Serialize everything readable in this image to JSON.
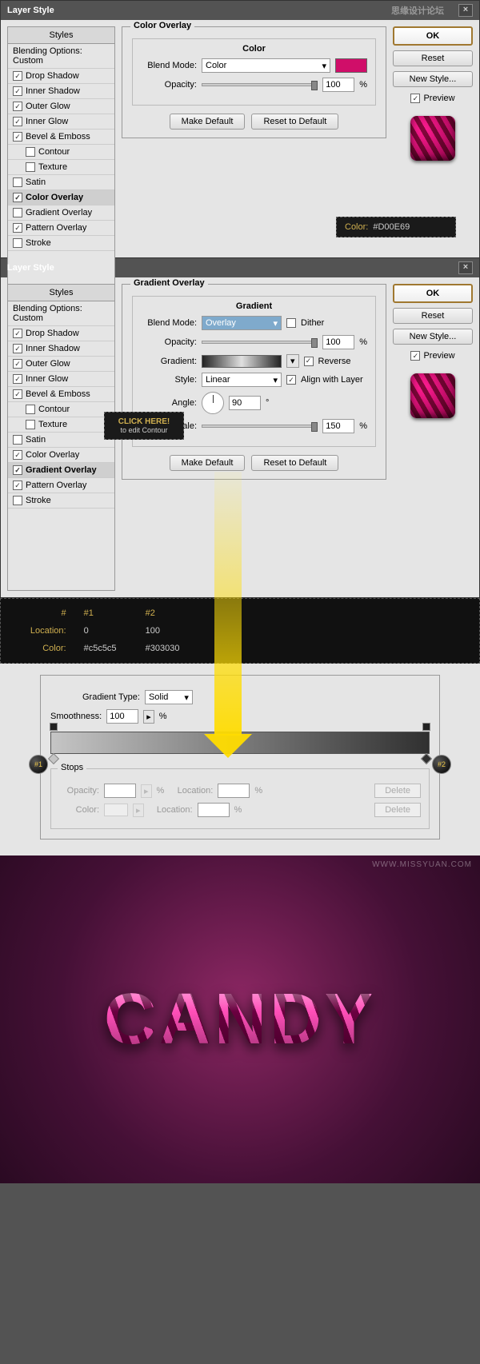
{
  "dialog_title": "Layer Style",
  "watermark_cn": "思缘设计论坛",
  "watermark_url": "WWW.MISSYUAN.COM",
  "styles_header": "Styles",
  "blending_opts": "Blending Options: Custom",
  "effects": [
    {
      "label": "Drop Shadow",
      "checked": true
    },
    {
      "label": "Inner Shadow",
      "checked": true
    },
    {
      "label": "Outer Glow",
      "checked": true
    },
    {
      "label": "Inner Glow",
      "checked": true
    },
    {
      "label": "Bevel & Emboss",
      "checked": true
    },
    {
      "label": "Contour",
      "checked": false,
      "indent": true
    },
    {
      "label": "Texture",
      "checked": false,
      "indent": true
    },
    {
      "label": "Satin",
      "checked": false
    },
    {
      "label": "Color Overlay",
      "checked": true
    },
    {
      "label": "Gradient Overlay",
      "checked": false
    },
    {
      "label": "Pattern Overlay",
      "checked": true
    },
    {
      "label": "Stroke",
      "checked": false
    }
  ],
  "color_overlay": {
    "title": "Color Overlay",
    "subtitle": "Color",
    "blend_label": "Blend Mode:",
    "blend_value": "Color",
    "swatch": "#D00E69",
    "opacity_label": "Opacity:",
    "opacity_value": "100",
    "pct": "%"
  },
  "buttons": {
    "make_default": "Make Default",
    "reset_default": "Reset to Default",
    "ok": "OK",
    "reset": "Reset",
    "new_style": "New Style...",
    "preview": "Preview"
  },
  "tooltip_color": {
    "key": "Color:",
    "val": "#D00E69"
  },
  "click_here": {
    "l1": "CLICK HERE!",
    "l2": "to edit Contour"
  },
  "grad_overlay": {
    "title": "Gradient Overlay",
    "subtitle": "Gradient",
    "blend_label": "Blend Mode:",
    "blend_value": "Overlay",
    "dither": "Dither",
    "opacity_label": "Opacity:",
    "opacity_value": "100",
    "gradient_label": "Gradient:",
    "reverse": "Reverse",
    "style_label": "Style:",
    "style_value": "Linear",
    "align": "Align with Layer",
    "angle_label": "Angle:",
    "angle_value": "90",
    "deg": "°",
    "scale_label": "Scale:",
    "scale_value": "150",
    "pct": "%"
  },
  "effects2": [
    {
      "label": "Drop Shadow",
      "checked": true
    },
    {
      "label": "Inner Shadow",
      "checked": true
    },
    {
      "label": "Outer Glow",
      "checked": true
    },
    {
      "label": "Inner Glow",
      "checked": true
    },
    {
      "label": "Bevel & Emboss",
      "checked": true
    },
    {
      "label": "Contour",
      "checked": false,
      "indent": true
    },
    {
      "label": "Texture",
      "checked": false,
      "indent": true
    },
    {
      "label": "Satin",
      "checked": false
    },
    {
      "label": "Color Overlay",
      "checked": true
    },
    {
      "label": "Gradient Overlay",
      "checked": true
    },
    {
      "label": "Pattern Overlay",
      "checked": true
    },
    {
      "label": "Stroke",
      "checked": false
    }
  ],
  "grad_table": {
    "h_num": "#",
    "h1": "#1",
    "h2": "#2",
    "loc": "Location:",
    "loc1": "0",
    "loc2": "100",
    "col": "Color:",
    "col1": "#c5c5c5",
    "col2": "#303030"
  },
  "grad_editor": {
    "type_label": "Gradient Type:",
    "type_value": "Solid",
    "smooth_label": "Smoothness:",
    "smooth_value": "100",
    "pct": "%",
    "stops_title": "Stops",
    "opacity": "Opacity:",
    "location": "Location:",
    "color": "Color:",
    "delete": "Delete",
    "b1": "#1",
    "b2": "#2"
  },
  "candy": "CANDY"
}
